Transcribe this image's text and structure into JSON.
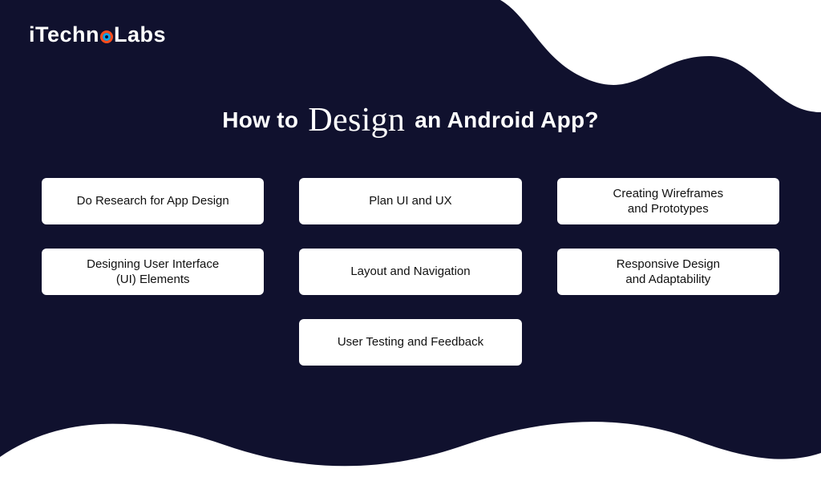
{
  "brand": {
    "prefix": "iTechn",
    "suffix": "Labs"
  },
  "title": {
    "before": "How to",
    "emphasis": "Design",
    "after": "an Android App?"
  },
  "cards": [
    "Do Research for App Design",
    "Plan UI and UX",
    "Creating Wireframes\nand Prototypes",
    "Designing User Interface\n(UI) Elements",
    "Layout and Navigation",
    "Responsive Design\nand Adaptability",
    "User Testing and Feedback"
  ]
}
